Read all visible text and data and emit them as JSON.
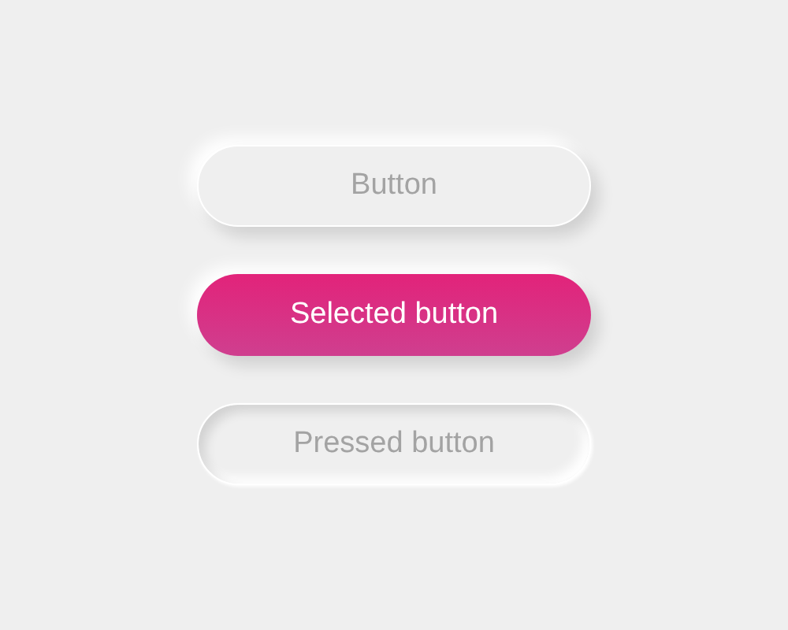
{
  "buttons": [
    {
      "label": "Button",
      "selected": false,
      "pressed": false
    },
    {
      "label": "Selected button",
      "selected": true,
      "pressed": false
    },
    {
      "label": "Pressed button",
      "selected": false,
      "pressed": true
    }
  ]
}
